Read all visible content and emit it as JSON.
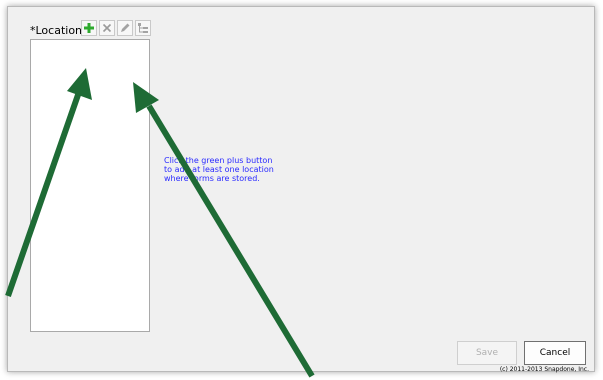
{
  "locations": {
    "label": "*Locations",
    "toolbar": {
      "add_icon": "green-plus-icon",
      "delete_icon": "delete-x-icon",
      "edit_icon": "pencil-icon",
      "tree_icon": "tree-view-icon"
    },
    "items": []
  },
  "hint_lines": [
    "Click the green plus button",
    "to add at least one location",
    "where forms are stored."
  ],
  "buttons": {
    "save": "Save",
    "cancel": "Cancel"
  },
  "copyright": "(c) 2011-2013 Snapdone, Inc.",
  "colors": {
    "hint_text": "#2a2aff",
    "annotation_arrow": "#1e6b35",
    "add_icon": "#2eaa2e"
  }
}
